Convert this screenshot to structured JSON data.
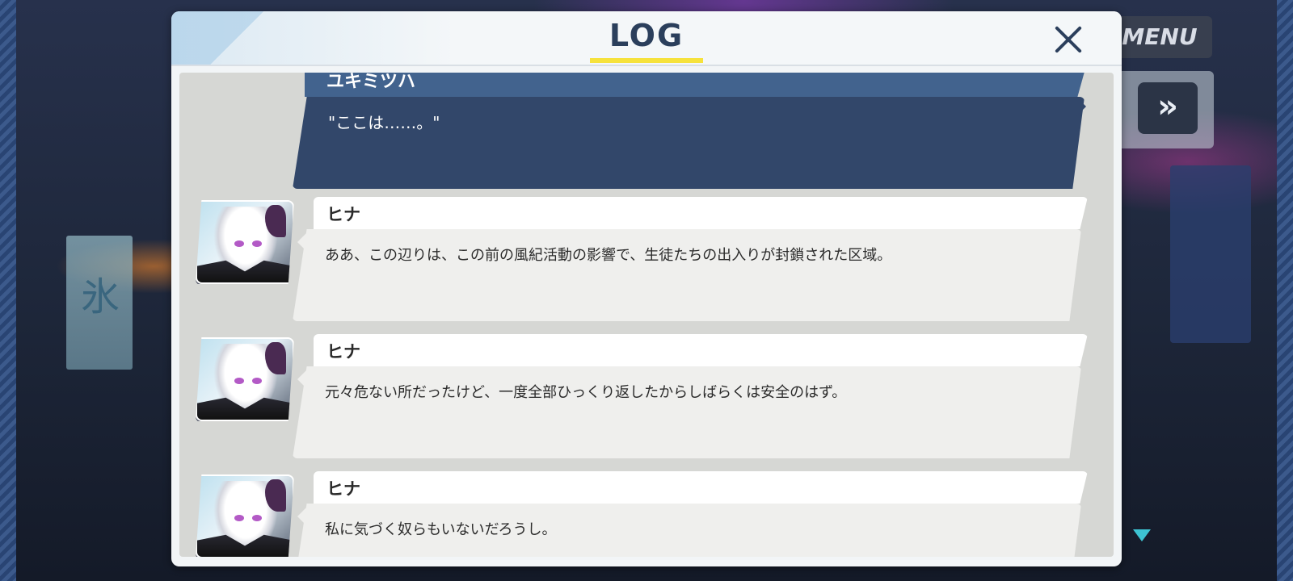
{
  "background": {
    "menu_label": "MENU",
    "skip_glyph": "»",
    "sign_glyph": "氷"
  },
  "log": {
    "title": "LOG",
    "accent_color": "#f6e23c",
    "entries": [
      {
        "speaker": "ユキミツハ",
        "text": "\"ここは……。\"",
        "selected": true
      },
      {
        "speaker": "ヒナ",
        "text": "ああ、この辺りは、この前の風紀活動の影響で、生徒たちの出入りが封鎖された区域。",
        "selected": false
      },
      {
        "speaker": "ヒナ",
        "text": "元々危ない所だったけど、一度全部ひっくり返したからしばらくは安全のはず。",
        "selected": false
      },
      {
        "speaker": "ヒナ",
        "text": "私に気づく奴らもいないだろうし。",
        "selected": false
      }
    ]
  }
}
